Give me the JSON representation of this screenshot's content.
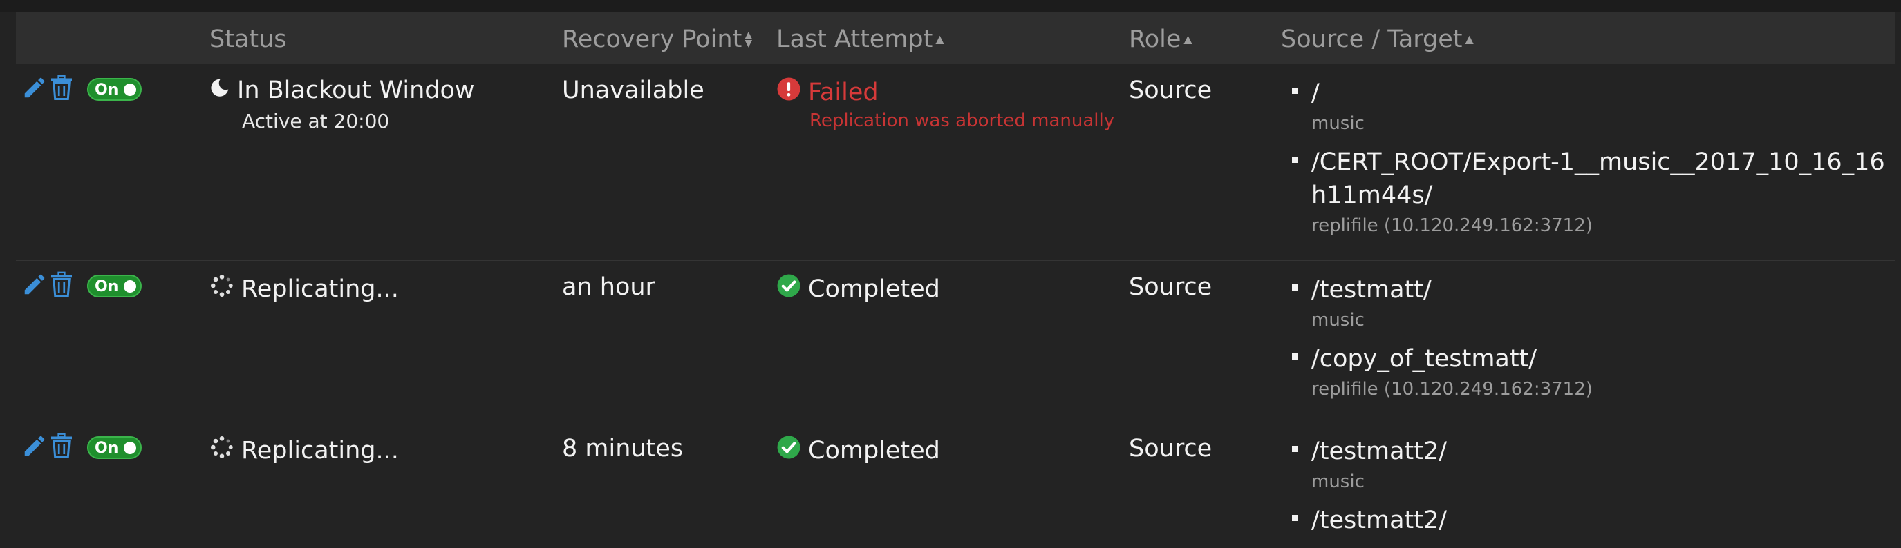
{
  "table": {
    "headers": {
      "status": "Status",
      "recovery_point": "Recovery Point",
      "last_attempt": "Last Attempt",
      "role": "Role",
      "source_target": "Source / Target"
    },
    "rows": [
      {
        "toggle": "On",
        "status": "In Blackout Window",
        "status_sub": "Active at 20:00",
        "recovery_point": "Unavailable",
        "last_attempt": "Failed",
        "last_attempt_sub": "Replication was aborted manually",
        "role": "Source",
        "sources": [
          {
            "path": "/",
            "sub": "music"
          },
          {
            "path": "/CERT_ROOT/Export-1__music__2017_10_16_16h11m44s/",
            "sub": "replifile (10.120.249.162:3712)"
          }
        ]
      },
      {
        "toggle": "On",
        "status": "Replicating...",
        "recovery_point": "an hour",
        "last_attempt": "Completed",
        "role": "Source",
        "sources": [
          {
            "path": "/testmatt/",
            "sub": "music"
          },
          {
            "path": "/copy_of_testmatt/",
            "sub": "replifile (10.120.249.162:3712)"
          }
        ]
      },
      {
        "toggle": "On",
        "status": "Replicating...",
        "recovery_point": "8 minutes",
        "last_attempt": "Completed",
        "role": "Source",
        "sources": [
          {
            "path": "/testmatt2/",
            "sub": "music"
          },
          {
            "path": "/testmatt2/",
            "sub": ""
          }
        ]
      }
    ]
  },
  "icons": {
    "edit": "pencil-icon",
    "delete": "trash-icon",
    "blackout": "moon-icon",
    "replicating": "spinner-icon",
    "failed": "error-icon",
    "completed": "check-circle-icon"
  },
  "colors": {
    "background": "#232323",
    "header_bg": "#2f2f2f",
    "header_text": "#9d9d9d",
    "accent_blue": "#3b8fd8",
    "toggle_green": "#1f8f2d",
    "failed_red": "#d63a3a",
    "completed_green": "#2fa84a"
  }
}
